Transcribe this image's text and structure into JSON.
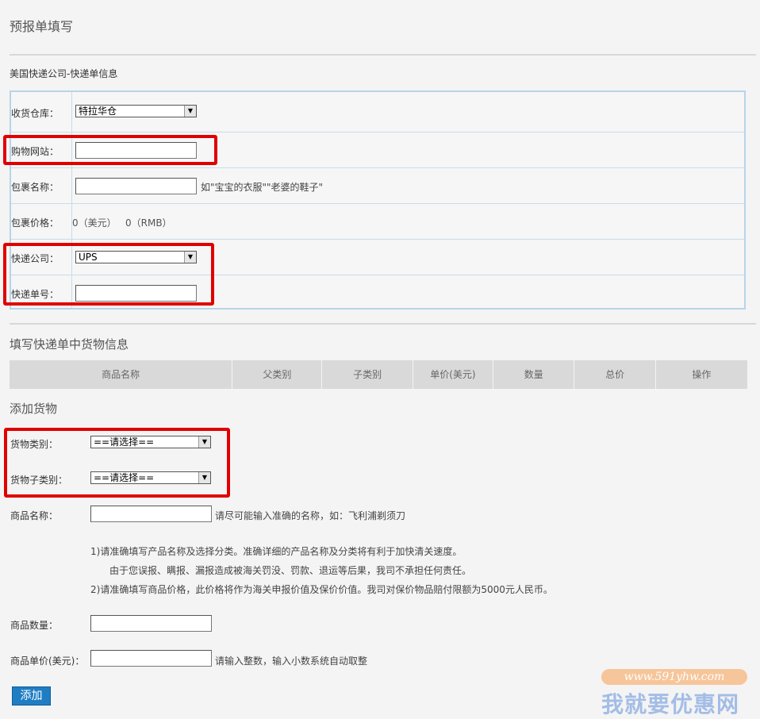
{
  "page_title": "预报单填写",
  "express_section": {
    "title": "美国快递公司-快递单信息",
    "warehouse": {
      "label": "收货仓库：",
      "selected": "特拉华仓"
    },
    "shop_site": {
      "label": "购物网站：",
      "value": ""
    },
    "package_name": {
      "label": "包裹名称：",
      "value": "",
      "hint": "如\"宝宝的衣服\"\"老婆的鞋子\""
    },
    "package_price": {
      "label": "包裹价格：",
      "usd": "0（美元）",
      "rmb": "0（RMB）"
    },
    "courier": {
      "label": "快递公司：",
      "selected": "UPS"
    },
    "tracking_no": {
      "label": "快递单号：",
      "value": ""
    }
  },
  "goods_section": {
    "title": "填写快递单中货物信息",
    "columns": [
      "商品名称",
      "父类别",
      "子类别",
      "单价(美元)",
      "数量",
      "总价",
      "操作"
    ]
  },
  "add_goods": {
    "title": "添加货物",
    "category": {
      "label": "货物类别：",
      "selected": "==请选择=="
    },
    "subcategory": {
      "label": "货物子类别：",
      "selected": "==请选择=="
    },
    "product_name": {
      "label": "商品名称：",
      "value": "",
      "hint": "请尽可能输入准确的名称，如：飞利浦剃须刀"
    },
    "notes": [
      "1)请准确填写产品名称及选择分类。准确详细的产品名称及分类将有利于加快清关速度。",
      "由于您误报、瞒报、漏报造成被海关罚没、罚款、退运等后果，我司不承担任何责任。",
      "2)请准确填写商品价格，此价格将作为海关申报价值及保价价值。我司对保价物品赔付限额为5000元人民币。"
    ],
    "quantity": {
      "label": "商品数量：",
      "value": ""
    },
    "unit_price": {
      "label": "商品单价(美元)：",
      "value": "",
      "hint": "请输入整数，输入小数系统自动取整"
    },
    "add_button": "添加"
  },
  "watermark": {
    "url": "www.591yhw.com",
    "text": "我就要优惠网"
  },
  "colors": {
    "highlight": "#e00000",
    "button": "#1f7ec3",
    "table_border": "#b8d4e8"
  }
}
